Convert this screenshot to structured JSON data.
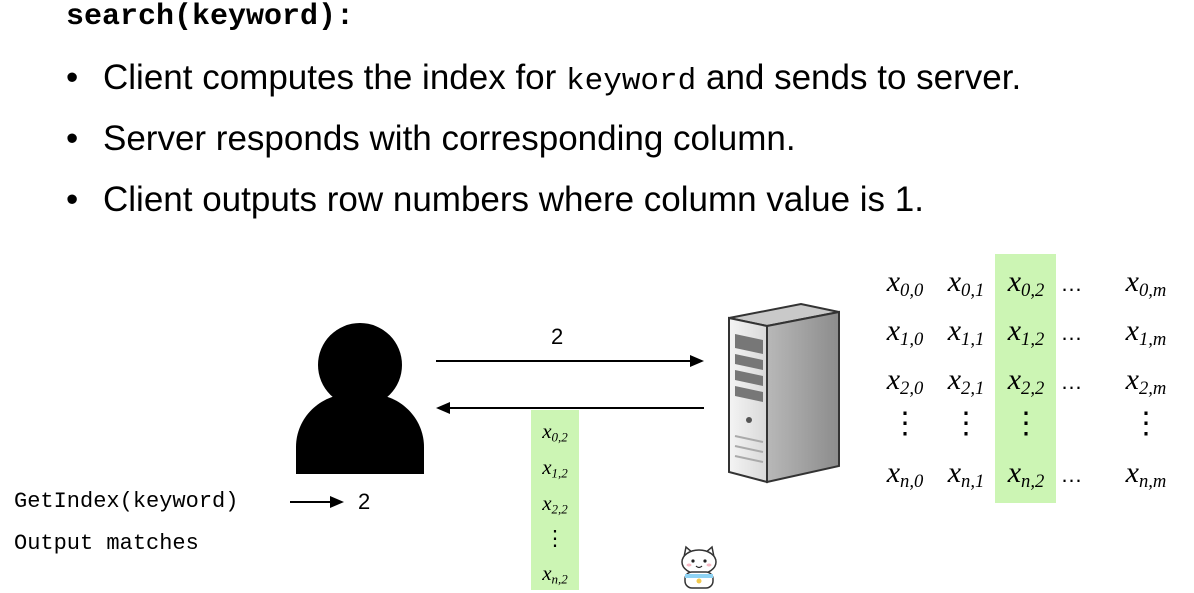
{
  "slide": {
    "title": "search(keyword):",
    "bullets": [
      {
        "pre": "Client computes the index for ",
        "code": "keyword",
        "post": " and sends to server."
      },
      {
        "pre": "Server responds with corresponding column.",
        "code": "",
        "post": ""
      },
      {
        "pre": "Client outputs row numbers where column value is 1.",
        "code": "",
        "post": ""
      }
    ]
  },
  "diagram": {
    "request_value": "2",
    "client": {
      "step1_call": "GetIndex(keyword)",
      "step1_result": "2",
      "step2": "Output matches"
    },
    "highlight_color": "#ccf5b4",
    "response_column": [
      {
        "var": "x",
        "sub": "0,2"
      },
      {
        "var": "x",
        "sub": "1,2"
      },
      {
        "var": "x",
        "sub": "2,2"
      },
      {
        "vdots": "⋮"
      },
      {
        "var": "x",
        "sub": "n,2"
      }
    ],
    "matrix": {
      "rows": [
        [
          {
            "var": "x",
            "sub": "0,0"
          },
          {
            "var": "x",
            "sub": "0,1"
          },
          {
            "var": "x",
            "sub": "0,2"
          },
          {
            "dots": "…"
          },
          {
            "var": "x",
            "sub": "0,m"
          }
        ],
        [
          {
            "var": "x",
            "sub": "1,0"
          },
          {
            "var": "x",
            "sub": "1,1"
          },
          {
            "var": "x",
            "sub": "1,2"
          },
          {
            "dots": "…"
          },
          {
            "var": "x",
            "sub": "1,m"
          }
        ],
        [
          {
            "var": "x",
            "sub": "2,0"
          },
          {
            "var": "x",
            "sub": "2,1"
          },
          {
            "var": "x",
            "sub": "2,2"
          },
          {
            "dots": "…"
          },
          {
            "var": "x",
            "sub": "2,m"
          }
        ],
        [
          {
            "vdots": "⋮"
          },
          {
            "vdots": "⋮"
          },
          {
            "vdots": "⋮"
          },
          {
            "blank": ""
          },
          {
            "vdots": "⋮"
          }
        ],
        [
          {
            "var": "x",
            "sub": "n,0"
          },
          {
            "var": "x",
            "sub": "n,1"
          },
          {
            "var": "x",
            "sub": "n,2"
          },
          {
            "dots": "…"
          },
          {
            "var": "x",
            "sub": "n,m"
          }
        ]
      ]
    }
  }
}
